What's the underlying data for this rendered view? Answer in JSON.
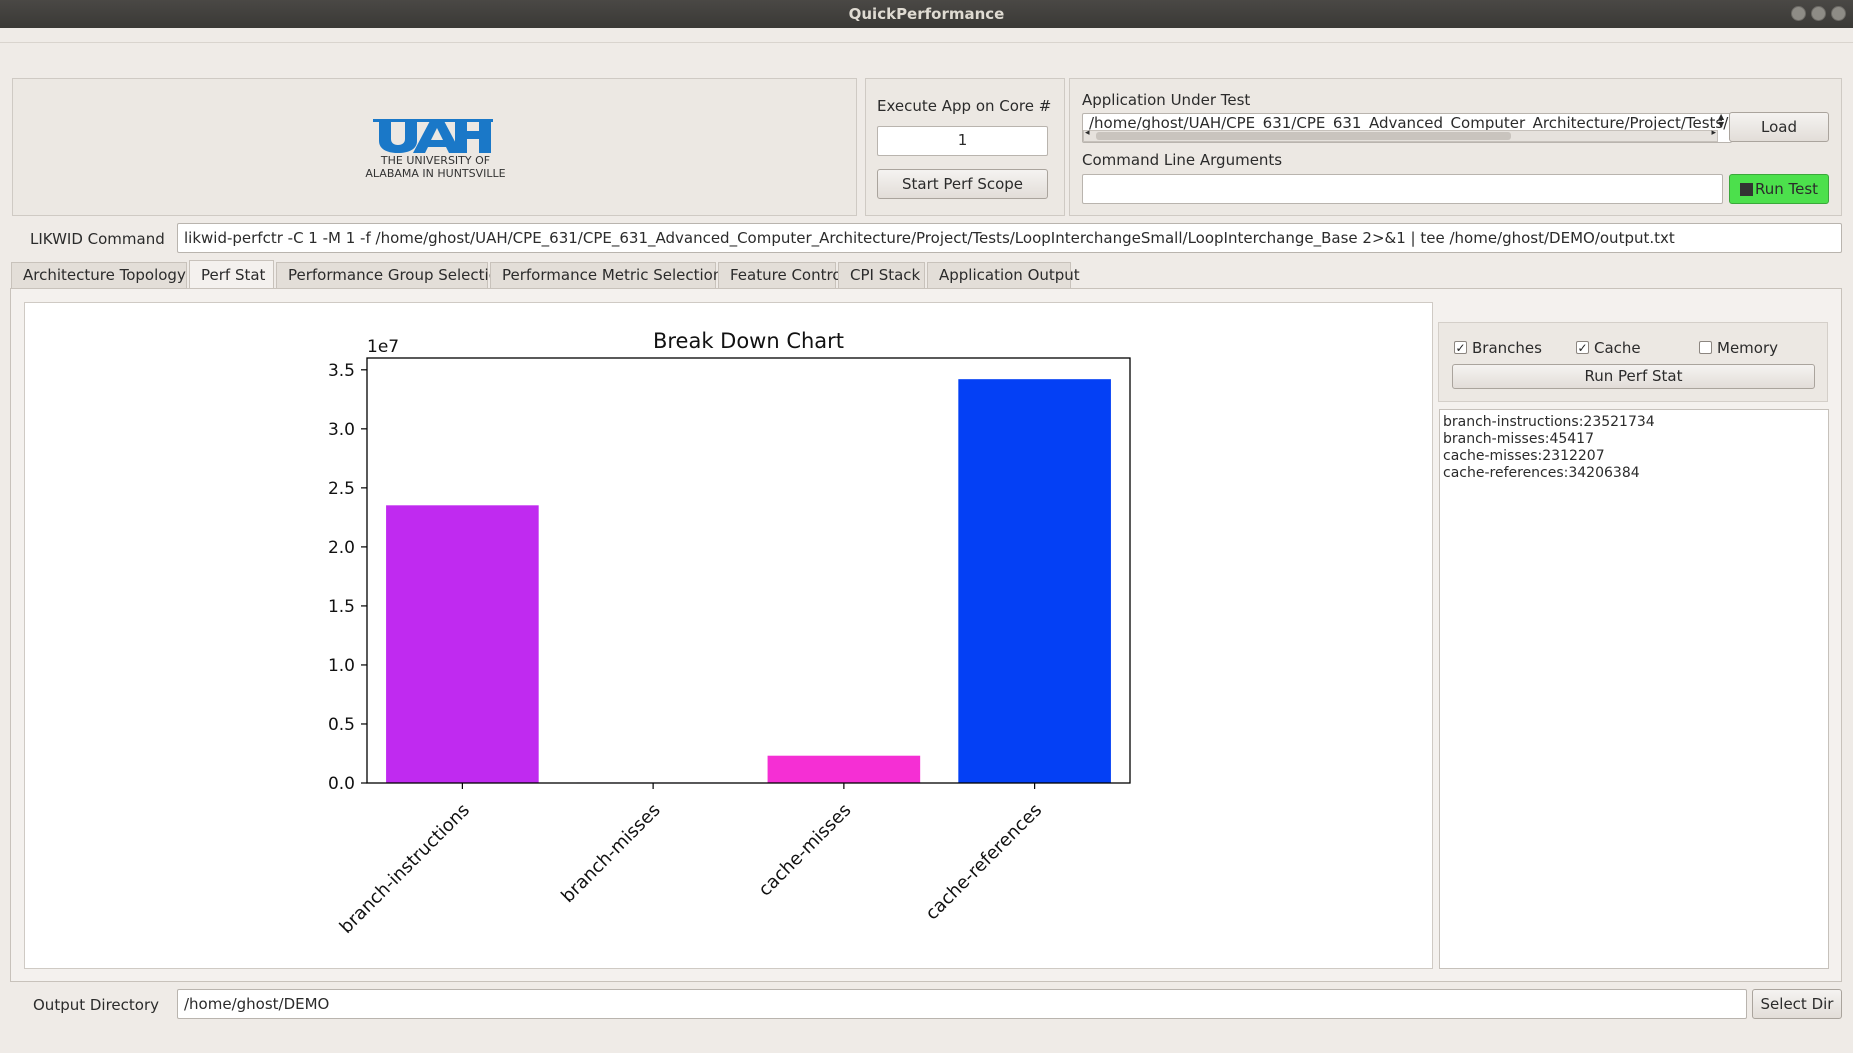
{
  "window": {
    "title": "QuickPerformance"
  },
  "logo": {
    "line1": "THE UNIVERSITY OF",
    "line2": "ALABAMA IN HUNTSVILLE",
    "color": "#1a78c8"
  },
  "core": {
    "label": "Execute App on Core #",
    "value": "1",
    "start_button": "Start Perf Scope"
  },
  "app": {
    "label": "Application Under Test",
    "path": "/home/ghost/UAH/CPE_631/CPE_631_Advanced_Computer_Architecture/Project/Tests/Loç",
    "load_button": "Load",
    "args_label": "Command Line Arguments",
    "args_value": "",
    "run_button": "Run Test"
  },
  "likwid": {
    "label": "LIKWID Command",
    "value": "likwid-perfctr -C 1 -M 1  -f /home/ghost/UAH/CPE_631/CPE_631_Advanced_Computer_Architecture/Project/Tests/LoopInterchangeSmall/LoopInterchange_Base  2>&1 | tee /home/ghost/DEMO/output.txt"
  },
  "tabs": [
    {
      "label": "Architecture Topology",
      "active": false
    },
    {
      "label": "Perf Stat",
      "active": true
    },
    {
      "label": "Performance Group Selection",
      "active": false
    },
    {
      "label": "Performance Metric Selection",
      "active": false
    },
    {
      "label": "Feature Control",
      "active": false
    },
    {
      "label": "CPI Stack",
      "active": false
    },
    {
      "label": "Application Output",
      "active": false
    }
  ],
  "chart_data": {
    "type": "bar",
    "title": "Break Down Chart",
    "scale_label": "1e7",
    "categories": [
      "branch-instructions",
      "branch-misses",
      "cache-misses",
      "cache-references"
    ],
    "values": [
      23521734,
      45417,
      2312207,
      34206384
    ],
    "colors": [
      "#c02af0",
      "#9a8cf0",
      "#f52fd4",
      "#0440f5"
    ],
    "ylim": [
      0,
      36000000
    ],
    "yticks": [
      0,
      5000000,
      10000000,
      15000000,
      20000000,
      25000000,
      30000000,
      35000000
    ],
    "ytick_labels": [
      "0.0",
      "0.5",
      "1.0",
      "1.5",
      "2.0",
      "2.5",
      "3.0",
      "3.5"
    ],
    "grid": false,
    "xlabel": "",
    "ylabel": ""
  },
  "perfstat": {
    "options": [
      {
        "label": "Branches",
        "checked": true
      },
      {
        "label": "Cache",
        "checked": true
      },
      {
        "label": "Memory",
        "checked": false
      }
    ],
    "run_button": "Run Perf Stat",
    "results": [
      "branch-instructions:23521734",
      "branch-misses:45417",
      "cache-misses:2312207",
      "cache-references:34206384"
    ]
  },
  "output": {
    "label": "Output Directory",
    "value": "/home/ghost/DEMO",
    "button": "Select Dir"
  },
  "colors": {
    "run_button_bg": "#4ce04c",
    "window_bg": "#efebe7"
  }
}
